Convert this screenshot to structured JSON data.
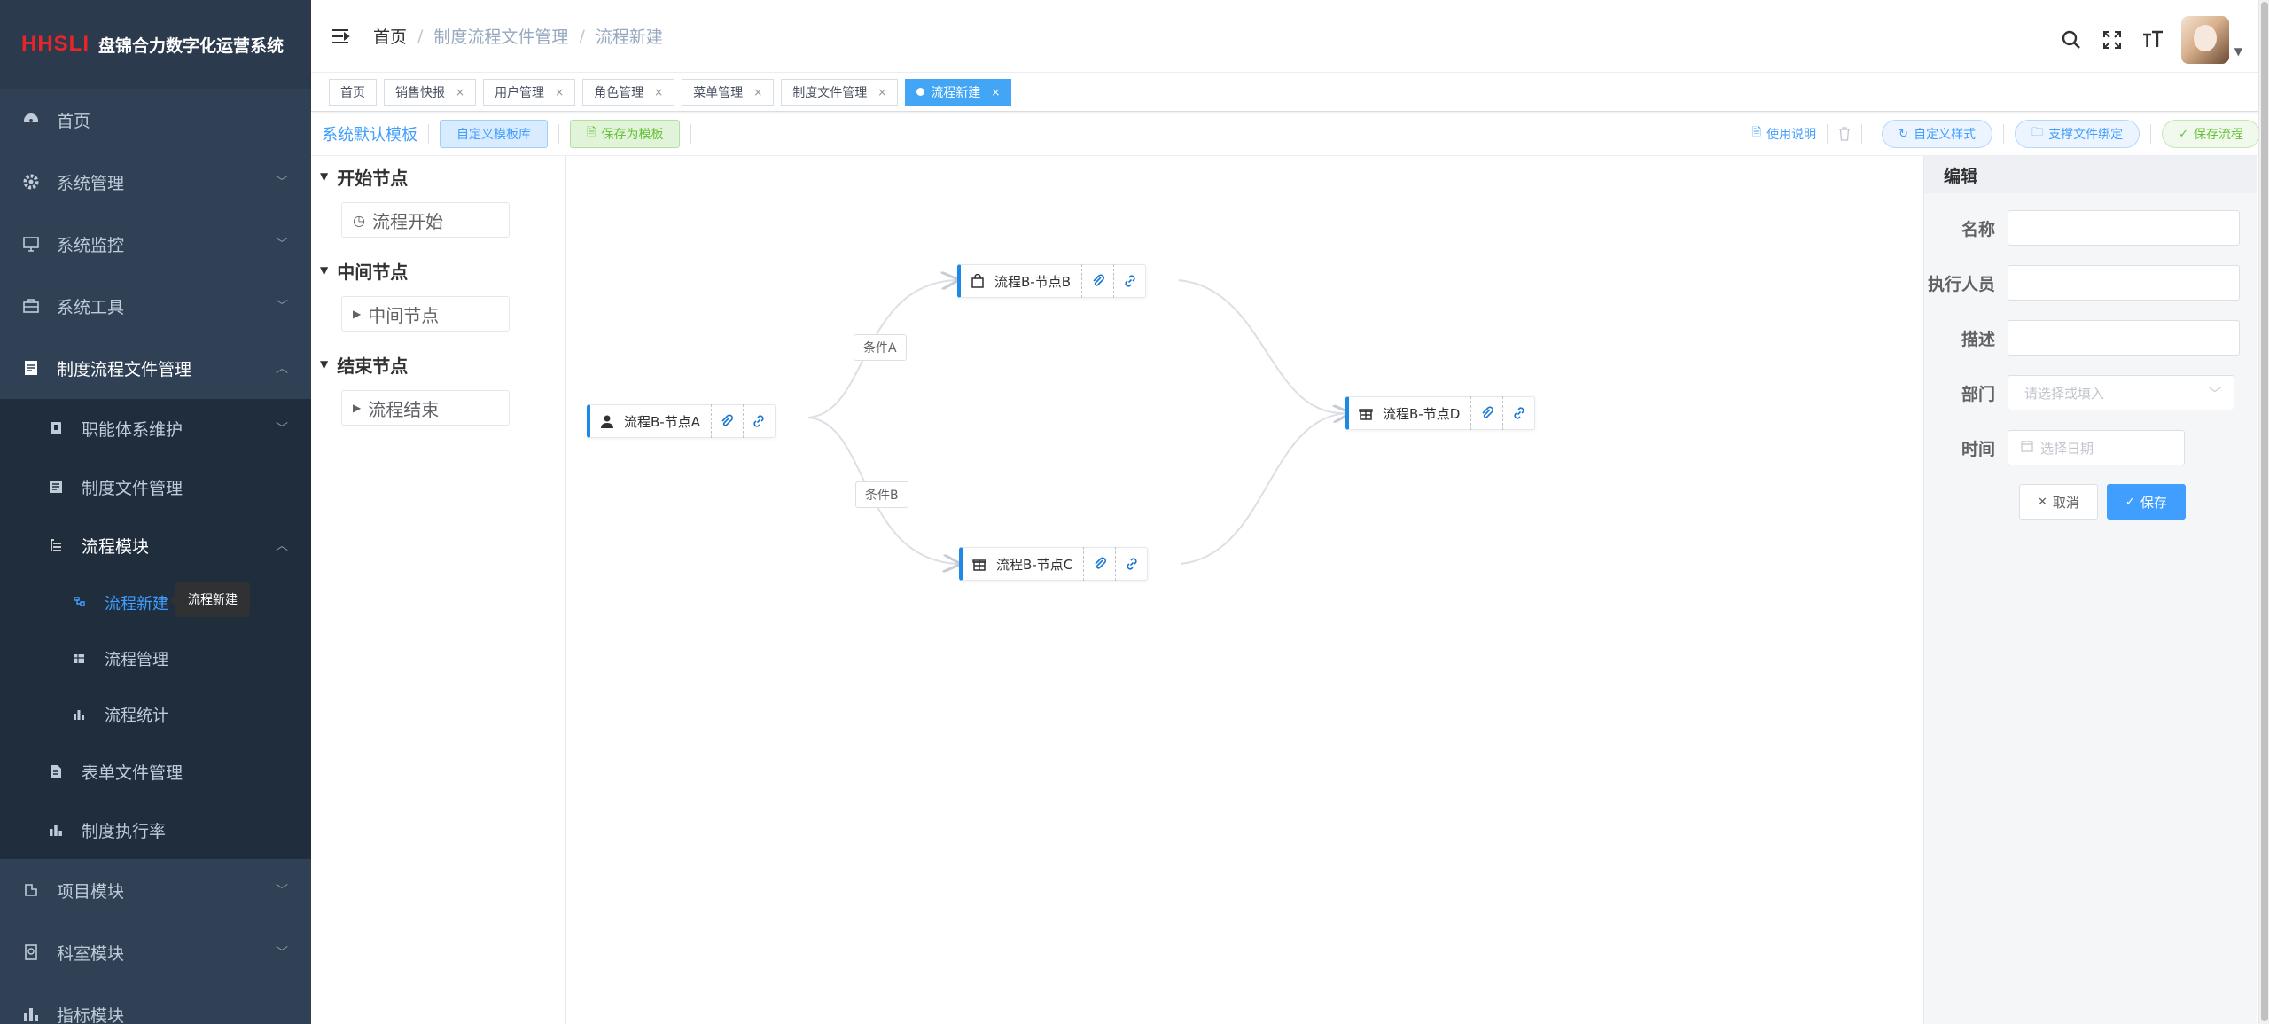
{
  "app": {
    "logo_mark": "HHSLI",
    "title": "盘锦合力数字化运营系统"
  },
  "sidebar": {
    "items": [
      {
        "label": "首页",
        "icon": "dashboard-icon"
      },
      {
        "label": "系统管理",
        "icon": "gear-icon"
      },
      {
        "label": "系统监控",
        "icon": "monitor-icon"
      },
      {
        "label": "系统工具",
        "icon": "toolbox-icon"
      },
      {
        "label": "制度流程文件管理",
        "icon": "document-icon"
      }
    ],
    "submenu": [
      {
        "label": "职能体系维护"
      },
      {
        "label": "制度文件管理"
      },
      {
        "label": "流程模块"
      }
    ],
    "submenu2": [
      {
        "label": "流程新建"
      },
      {
        "label": "流程管理"
      },
      {
        "label": "流程统计"
      }
    ],
    "submenu_after": [
      {
        "label": "表单文件管理"
      },
      {
        "label": "制度执行率"
      }
    ],
    "bottom": [
      {
        "label": "项目模块"
      },
      {
        "label": "科室模块"
      },
      {
        "label": "指标模块"
      }
    ],
    "tooltip": "流程新建"
  },
  "breadcrumb": {
    "home": "首页",
    "parent": "制度流程文件管理",
    "current": "流程新建"
  },
  "tags": [
    {
      "label": "首页",
      "closable": false
    },
    {
      "label": "销售快报",
      "closable": true
    },
    {
      "label": "用户管理",
      "closable": true
    },
    {
      "label": "角色管理",
      "closable": true
    },
    {
      "label": "菜单管理",
      "closable": true
    },
    {
      "label": "制度文件管理",
      "closable": true
    },
    {
      "label": "流程新建",
      "closable": true,
      "active": true
    }
  ],
  "toolbar": {
    "default_template": "系统默认模板",
    "custom_library": "自定义模板库",
    "save_as_template": "保存为模板",
    "usage": "使用说明",
    "custom_style": "自定义样式",
    "bind_files": "支撑文件绑定",
    "save_flow": "保存流程"
  },
  "node_panel": {
    "groups": [
      {
        "title": "开始节点",
        "item": "流程开始"
      },
      {
        "title": "中间节点",
        "item": "中间节点"
      },
      {
        "title": "结束节点",
        "item": "流程结束"
      }
    ]
  },
  "canvas": {
    "nodes": {
      "a": "流程B-节点A",
      "b": "流程B-节点B",
      "c": "流程B-节点C",
      "d": "流程B-节点D"
    },
    "conditions": {
      "a": "条件A",
      "b": "条件B"
    }
  },
  "edit_panel": {
    "title": "编辑",
    "name_label": "名称",
    "executor_label": "执行人员",
    "desc_label": "描述",
    "dept_label": "部门",
    "dept_placeholder": "请选择或填入",
    "time_label": "时间",
    "time_placeholder": "选择日期",
    "cancel": "取消",
    "save": "保存"
  },
  "colors": {
    "sidebar_bg": "#304156",
    "accent": "#409eff",
    "node_border": "#1e88e5"
  }
}
